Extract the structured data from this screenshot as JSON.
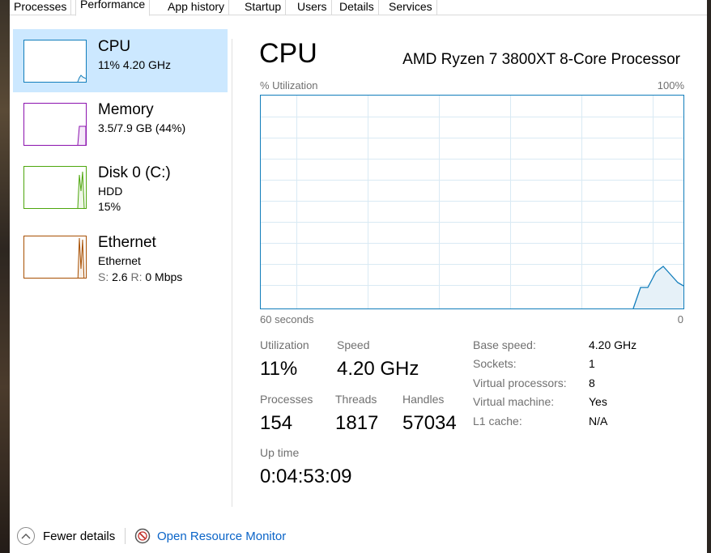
{
  "tabs": [
    {
      "label": "Processes"
    },
    {
      "label": "Performance",
      "active": true
    },
    {
      "label": "App history"
    },
    {
      "label": "Startup"
    },
    {
      "label": "Users"
    },
    {
      "label": "Details"
    },
    {
      "label": "Services"
    }
  ],
  "sidebar": {
    "items": [
      {
        "title": "CPU",
        "sub1": "11%  4.20 GHz",
        "color": "#117dbb"
      },
      {
        "title": "Memory",
        "sub1": "3.5/7.9 GB (44%)",
        "color": "#8b12ae"
      },
      {
        "title": "Disk 0 (C:)",
        "sub1": "HDD",
        "sub2": "15%",
        "color": "#4da60c"
      },
      {
        "title": "Ethernet",
        "sub1": "Ethernet",
        "sub2_s_label": "S:",
        "sub2_s_value": "2.6",
        "sub2_r_label": "R:",
        "sub2_r_value": "0 Mbps",
        "color": "#a74f01"
      }
    ]
  },
  "main": {
    "title": "CPU",
    "processor": "AMD Ryzen 7 3800XT 8-Core Processor",
    "graph": {
      "y_label": "% Utilization",
      "y_max_label": "100%",
      "x_left_label": "60 seconds",
      "x_right_label": "0",
      "line_color": "#117dbb",
      "grid_color": "#d9eaf4"
    },
    "stats": {
      "utilization_label": "Utilization",
      "utilization_value": "11%",
      "speed_label": "Speed",
      "speed_value": "4.20 GHz",
      "processes_label": "Processes",
      "processes_value": "154",
      "threads_label": "Threads",
      "threads_value": "1817",
      "handles_label": "Handles",
      "handles_value": "57034",
      "uptime_label": "Up time",
      "uptime_value": "0:04:53:09"
    },
    "specs": [
      {
        "label": "Base speed:",
        "value": "4.20 GHz"
      },
      {
        "label": "Sockets:",
        "value": "1"
      },
      {
        "label": "Virtual processors:",
        "value": "8"
      },
      {
        "label": "Virtual machine:",
        "value": "Yes"
      },
      {
        "label": "L1 cache:",
        "value": "N/A"
      }
    ]
  },
  "footer": {
    "fewer_details": "Fewer details",
    "open_resource_monitor": "Open Resource Monitor"
  }
}
